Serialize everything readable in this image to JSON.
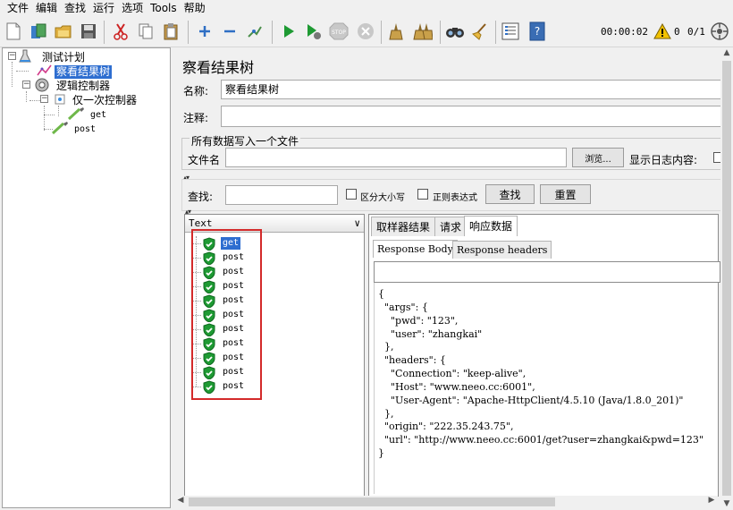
{
  "menu": [
    "文件",
    "编辑",
    "查找",
    "运行",
    "选项",
    "Tools",
    "帮助"
  ],
  "toolbar": {
    "icons": [
      "new-icon",
      "templates-icon",
      "open-icon",
      "save-icon",
      "cut-icon",
      "copy-icon",
      "paste-icon",
      "expand-icon",
      "collapse-icon",
      "toggle-icon",
      "start-icon",
      "start-no-pauses-icon",
      "stop-icon",
      "shutdown-icon",
      "clear-icon",
      "clear-all-icon",
      "search-icon",
      "reset-search-icon",
      "function-helper-icon",
      "help-icon",
      "warning-icon",
      "remote-icon"
    ],
    "timer": "00:00:02",
    "warnings": "0",
    "threads": "0/1"
  },
  "tree": {
    "nodes": [
      {
        "label": "测试计划"
      },
      {
        "label": "察看结果树"
      },
      {
        "label": "逻辑控制器"
      },
      {
        "label": "仅一次控制器"
      },
      {
        "label": "get"
      },
      {
        "label": "post"
      }
    ]
  },
  "panel": {
    "title": "察看结果树",
    "name_label": "名称:",
    "name_value": "察看结果树",
    "comment_label": "注释:",
    "comment_value": "",
    "file_section": "所有数据写入一个文件",
    "filename_label": "文件名",
    "filename_value": "",
    "browse_button": "浏览...",
    "log_label": "显示日志内容:"
  },
  "search": {
    "label": "查找:",
    "value": "",
    "case_label": "区分大小写",
    "regex_label": "正则表达式",
    "search_button": "查找",
    "reset_button": "重置"
  },
  "results": {
    "renderer": "Text",
    "samples": [
      "get",
      "post",
      "post",
      "post",
      "post",
      "post",
      "post",
      "post",
      "post",
      "post",
      "post"
    ]
  },
  "details": {
    "tabs": [
      "取样器结果",
      "请求",
      "响应数据"
    ],
    "active_tab": "响应数据",
    "subtabs": [
      "Response Body",
      "Response headers"
    ],
    "body_lines": [
      "{",
      "  \"args\": {",
      "    \"pwd\": \"123\",",
      "    \"user\": \"zhangkai\"",
      "  },",
      "  \"headers\": {",
      "    \"Connection\": \"keep-alive\",",
      "    \"Host\": \"www.neeo.cc:6001\",",
      "    \"User-Agent\": \"Apache-HttpClient/4.5.10 (Java/1.8.0_201)\"",
      "  },",
      "  \"origin\": \"222.35.243.75\",",
      "  \"url\": \"http://www.neeo.cc:6001/get?user=zhangkai&pwd=123\"",
      "}"
    ]
  },
  "colors": {
    "selection": "#2e6ed0",
    "success": "#1e9a33",
    "highlight_box": "#d32a2a"
  }
}
